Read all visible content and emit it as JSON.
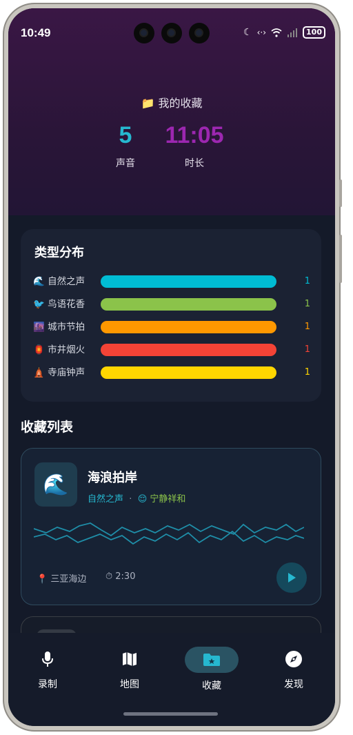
{
  "status_bar": {
    "time": "10:49",
    "battery": "100",
    "icons": [
      "moon-icon",
      "data-transfer-icon",
      "wifi-icon",
      "signal-icon"
    ]
  },
  "header": {
    "title": "我的收藏",
    "title_icon": "📁"
  },
  "stats": [
    {
      "value": "5",
      "label": "声音",
      "color": "#26b8d0"
    },
    {
      "value": "11:05",
      "label": "时长",
      "color": "#9c27b0"
    }
  ],
  "distribution": {
    "title": "类型分布",
    "items": [
      {
        "icon": "🌊",
        "label": "自然之声",
        "count": "1",
        "color": "#00bcd4"
      },
      {
        "icon": "🐦",
        "label": "鸟语花香",
        "count": "1",
        "color": "#8bc34a"
      },
      {
        "icon": "🌆",
        "label": "城市节拍",
        "count": "1",
        "color": "#ff9800"
      },
      {
        "icon": "🏮",
        "label": "市井烟火",
        "count": "1",
        "color": "#f44336"
      },
      {
        "icon": "🛕",
        "label": "寺庙钟声",
        "count": "1",
        "color": "#ffd600"
      }
    ]
  },
  "list": {
    "title": "收藏列表",
    "items": [
      {
        "thumb": "🌊",
        "name": "海浪拍岸",
        "category": "自然之声",
        "separator": "·",
        "mood_icon": "😌",
        "mood": "宁静祥和",
        "location": "三亚海边",
        "duration": "2:30"
      }
    ]
  },
  "nav": {
    "tabs": [
      {
        "label": "录制",
        "icon": "mic-icon",
        "active": false
      },
      {
        "label": "地图",
        "icon": "map-icon",
        "active": false
      },
      {
        "label": "收藏",
        "icon": "folder-star-icon",
        "active": true
      },
      {
        "label": "发现",
        "icon": "compass-icon",
        "active": false
      }
    ]
  }
}
